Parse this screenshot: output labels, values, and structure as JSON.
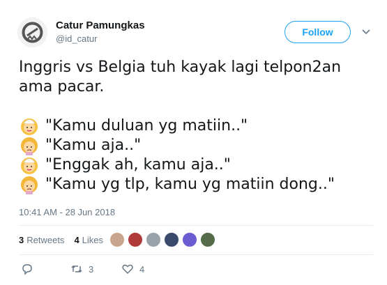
{
  "user": {
    "name": "Catur Pamungkas",
    "handle": "@id_catur"
  },
  "follow_label": "Follow",
  "tweet": {
    "lines": [
      "Inggris vs Belgia tuh kayak lagi telpon2an",
      "ama pacar.",
      "\"Kamu duluan yg matiin..\"",
      "\"Kamu aja..\"",
      "\"Enggak ah, kamu aja..\"",
      "\"Kamu yg tlp, kamu yg matiin dong..\""
    ],
    "emoji_names": [
      "woman-with-veil-icon",
      "woman-frowning-icon",
      "woman-with-veil-icon",
      "woman-frowning-icon"
    ]
  },
  "timestamp": "10:41 AM - 28 Jun 2018",
  "stats": {
    "retweets_count": "3",
    "retweets_label": "Retweets",
    "likes_count": "4",
    "likes_label": "Likes"
  },
  "liker_colors": [
    "#c9a48e",
    "#b03a3a",
    "#9aa3ab",
    "#3a4a6a",
    "#6d5bd0",
    "#556b4a"
  ],
  "actions": {
    "reply_count": "",
    "retweet_count": "3",
    "like_count": "4"
  },
  "colors": {
    "accent": "#1da1f2",
    "muted": "#657786",
    "text": "#14171a"
  }
}
